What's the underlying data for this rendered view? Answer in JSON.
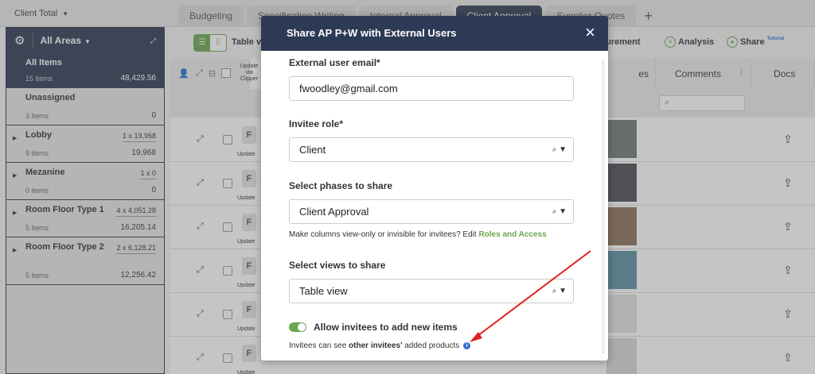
{
  "topbar": {
    "client_total": "Client Total",
    "tabs": [
      "Budgeting",
      "Specification Writing",
      "Internal Approval",
      "Client Approval",
      "Supplier Quotes"
    ],
    "active_tab_index": 3,
    "add_tab": "+"
  },
  "sidebar": {
    "title": "All Areas",
    "items": [
      {
        "name": "All Items",
        "sub": "15 items",
        "value": "48,429.56",
        "mult": ""
      },
      {
        "name": "Unassigned",
        "sub": "3 items",
        "value": "0",
        "mult": ""
      },
      {
        "name": "Lobby",
        "sub": "9 items",
        "value": "19,968",
        "mult": "1 x 19,968"
      },
      {
        "name": "Mezanine",
        "sub": "0 items",
        "value": "0",
        "mult": "1 x 0"
      },
      {
        "name": "Room Floor Type 1",
        "sub": "5 items",
        "value": "16,205.14",
        "mult": "4 x 4,051.28"
      },
      {
        "name": "Room Floor Type 2",
        "sub": "5 items",
        "value": "12,256.42",
        "mult": "2 x 6,128.21"
      }
    ]
  },
  "toolbar": {
    "view_label": "Table v",
    "procurement": "curement",
    "analysis": "Analysis",
    "share": "Share",
    "share_tutorial": "Tutorial"
  },
  "table": {
    "header_update": "Update via Clipper",
    "header_images": "es",
    "header_comments": "Comments",
    "header_docs": "Docs",
    "row_update_label": "Update",
    "row_count": 6
  },
  "modal": {
    "title": "Share AP P+W with External Users",
    "close": "×",
    "email_label": "External user email*",
    "email_value": "fwoodley@gmail.com",
    "role_label": "Invitee role*",
    "role_value": "Client",
    "phases_label": "Select phases to share",
    "phases_value": "Client Approval",
    "phases_helper_prefix": "Make columns view-only or invisible for invitees? Edit ",
    "phases_helper_link": "Roles and Access",
    "views_label": "Select views to share",
    "views_value": "Table view",
    "toggle_label": "Allow invitees to add new items",
    "toggle_on": true,
    "invitees_note_prefix": "Invitees can see ",
    "invitees_note_bold": "other invitees'",
    "invitees_note_suffix": " added products"
  },
  "colors": {
    "navy": "#2d3a55",
    "green": "#6aa84f",
    "annotation_red": "#e02020",
    "info_blue": "#3b6fd0"
  },
  "icons": [
    "gear-icon",
    "caret-down-icon",
    "expand-icon",
    "close-icon",
    "search-icon",
    "upload-icon",
    "info-icon",
    "plus-icon"
  ]
}
